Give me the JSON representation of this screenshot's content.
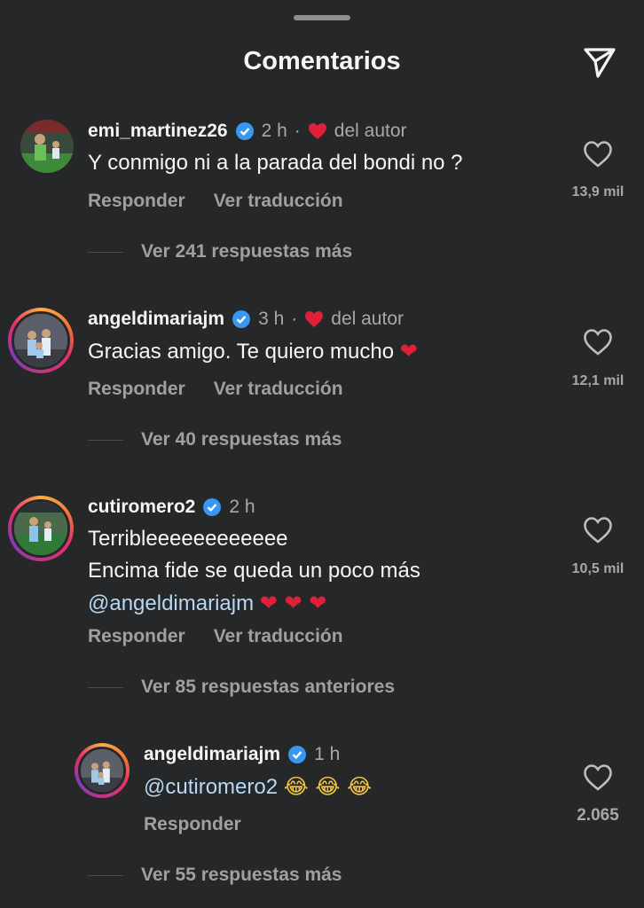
{
  "header": {
    "title": "Comentarios",
    "share_icon": "paper-plane-icon"
  },
  "comments": [
    {
      "username": "emi_martinez26",
      "time": "2 h",
      "author_like": "del autor",
      "text_lines": [
        "Y conmigo ni a la parada del bondi no ?"
      ],
      "reply_label": "Responder",
      "translate_label": "Ver traducción",
      "likes": "13,9 mil",
      "more_replies": "Ver 241 respuestas más"
    },
    {
      "username": "angeldimariajm",
      "time": "3 h",
      "author_like": "del autor",
      "text_lines": [
        "Gracias amigo. Te quiero mucho"
      ],
      "emoji": "❤",
      "reply_label": "Responder",
      "translate_label": "Ver traducción",
      "likes": "12,1 mil",
      "more_replies": "Ver 40 respuestas más"
    },
    {
      "username": "cutiromero2",
      "time": "2 h",
      "text_lines": [
        "Terribleeeeeeeeeeee",
        "Encima fide se queda un poco más"
      ],
      "mention": "@angeldimariajm",
      "emoji": "❤ ❤ ❤",
      "reply_label": "Responder",
      "translate_label": "Ver traducción",
      "likes": "10,5 mil",
      "more_replies": "Ver 85 respuestas anteriores"
    }
  ],
  "reply": {
    "username": "angeldimariajm",
    "time": "1 h",
    "mention": "@cutiromero2",
    "emoji": "😂 😂 😂",
    "reply_label": "Responder",
    "likes": "2.065",
    "more_replies": "Ver 55 respuestas más"
  },
  "colors": {
    "background": "#262729",
    "mention": "#b8d6f5",
    "verified": "#3897f0",
    "heart": "#e0203a"
  }
}
